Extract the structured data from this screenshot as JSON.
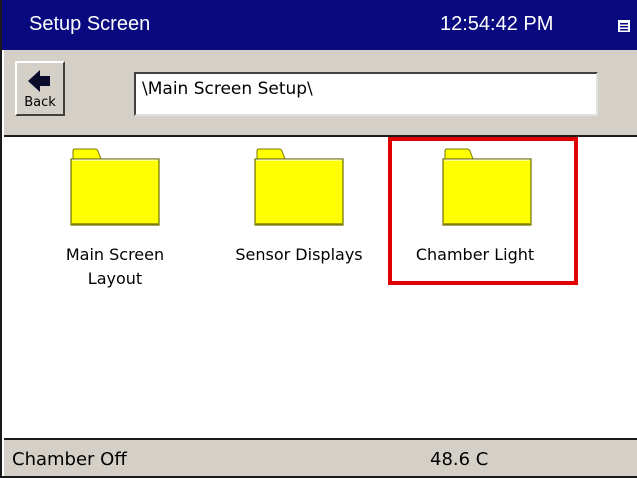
{
  "titlebar": {
    "title": "Setup Screen",
    "time": "12:54:42 PM",
    "menu_icon": "menu-icon"
  },
  "toolbar": {
    "back_label": "Back",
    "back_icon": "arrow-left-icon",
    "path": "\\Main Screen Setup\\"
  },
  "folders": [
    {
      "label_line1": "Main Screen",
      "label_line2": "Layout",
      "icon": "folder-icon",
      "selected": false
    },
    {
      "label_line1": "Sensor Displays",
      "label_line2": "",
      "icon": "folder-icon",
      "selected": false
    },
    {
      "label_line1": "Chamber Light",
      "label_line2": "",
      "icon": "folder-icon",
      "selected": true
    }
  ],
  "status": {
    "left": "Chamber Off",
    "right": "48.6 C"
  },
  "colors": {
    "titlebar_bg": "#0a0a80",
    "folder_fill": "#ffff00",
    "highlight": "#e00000",
    "chrome": "#d4d0c8"
  }
}
